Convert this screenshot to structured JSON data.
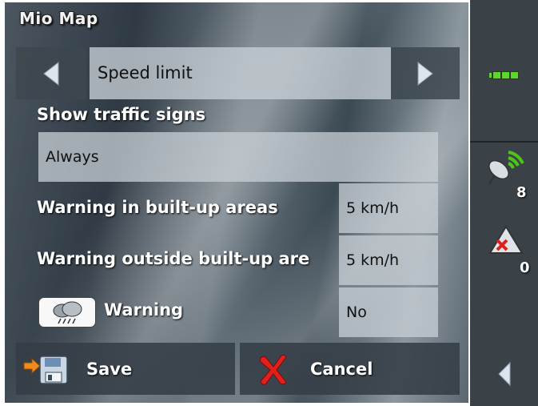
{
  "app": {
    "title": "Mio Map"
  },
  "navigator": {
    "label": "Speed limit"
  },
  "traffic_signs": {
    "label": "Show traffic signs",
    "value": "Always"
  },
  "rows": [
    {
      "label": "Warning in built-up areas",
      "value": "5 km/h"
    },
    {
      "label": "Warning outside built-up are",
      "value": "5 km/h"
    },
    {
      "label": "Warning",
      "value": "No"
    }
  ],
  "buttons": {
    "save": "Save",
    "cancel": "Cancel"
  },
  "status": {
    "satellites": "8",
    "alerts": "0"
  },
  "colors": {
    "battery": "#5bd62a",
    "gps": "#4fc21e",
    "cancel": "#e0201a",
    "save_arrow": "#f08a1c"
  },
  "icons": {
    "prev": "left-arrow-icon",
    "next": "right-arrow-icon",
    "weather": "rain-cloud-icon",
    "save": "floppy-disk-icon",
    "cancel": "red-x-icon",
    "battery": "battery-icon",
    "gps": "satellite-dish-icon",
    "alert": "warning-triangle-icon",
    "back": "back-arrow-icon"
  }
}
